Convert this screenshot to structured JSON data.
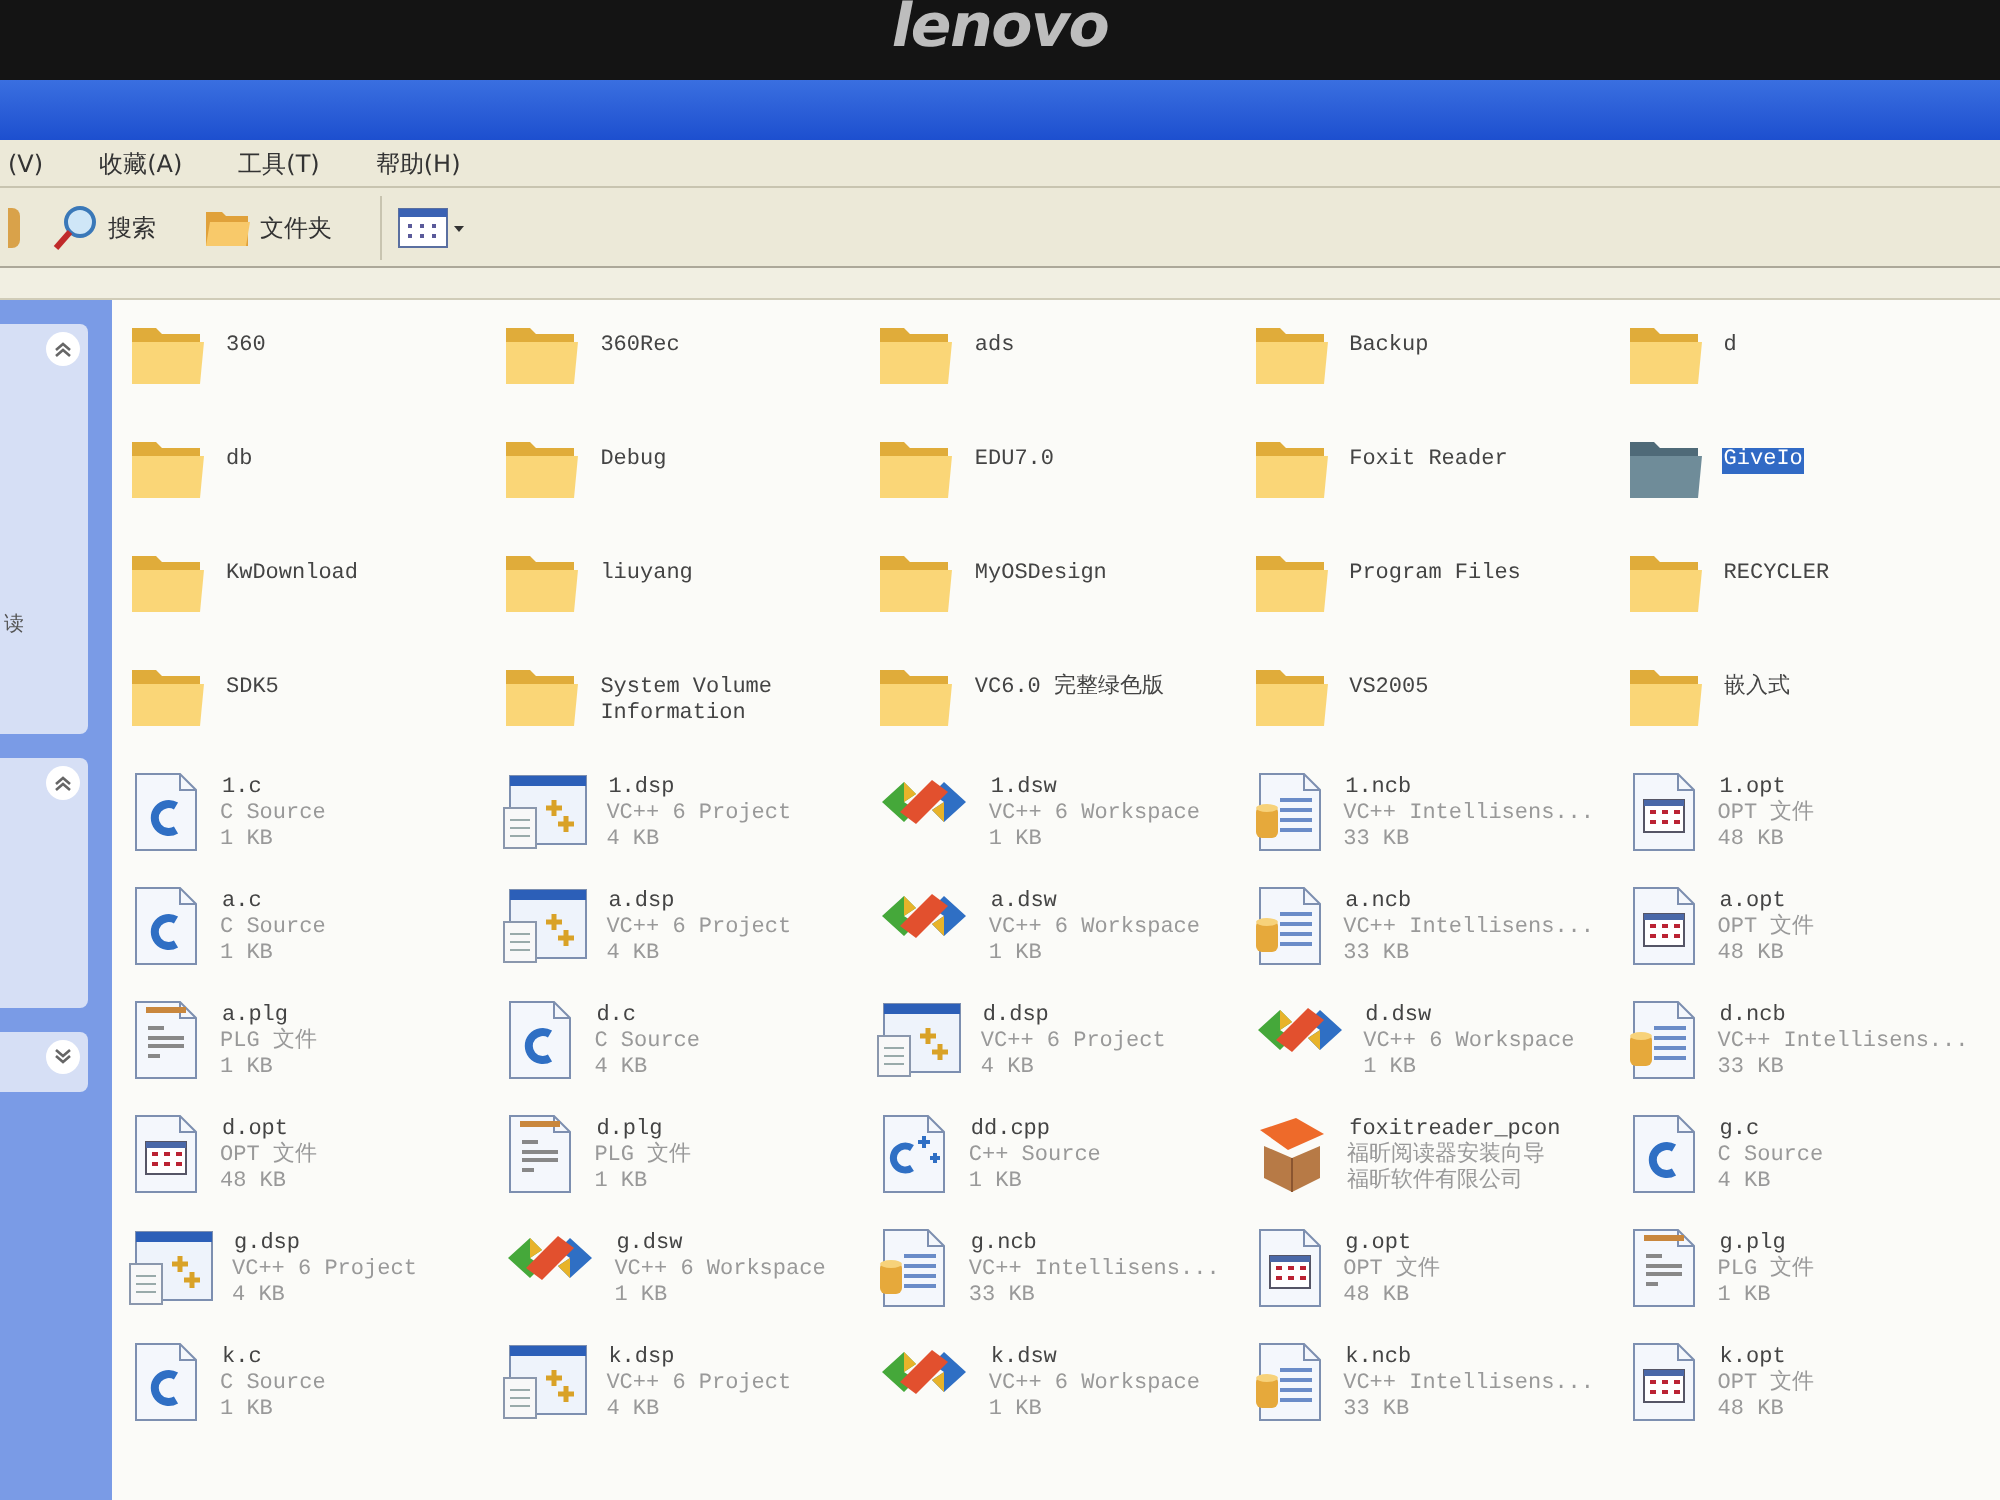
{
  "bezel": {
    "logo": "lenovo"
  },
  "menu": [
    "(V)",
    "收藏(A)",
    "工具(T)",
    "帮助(H)"
  ],
  "toolbar": [
    {
      "kind": "search",
      "label": "搜索"
    },
    {
      "kind": "folders",
      "label": "文件夹"
    },
    {
      "kind": "views"
    }
  ],
  "task_pane": {
    "text": "读",
    "panels": [
      {
        "expanded": true
      },
      {
        "expanded": true
      },
      {
        "expanded": false
      }
    ]
  },
  "items": [
    {
      "kind": "folder",
      "name": "360",
      "selected": false
    },
    {
      "kind": "folder",
      "name": "360Rec",
      "selected": false
    },
    {
      "kind": "folder",
      "name": "ads",
      "selected": false
    },
    {
      "kind": "folder",
      "name": "Backup",
      "selected": false
    },
    {
      "kind": "folder",
      "name": "d",
      "selected": false
    },
    {
      "kind": "folder",
      "name": "db",
      "selected": false
    },
    {
      "kind": "folder",
      "name": "Debug",
      "selected": false
    },
    {
      "kind": "folder",
      "name": "EDU7.0",
      "selected": false
    },
    {
      "kind": "folder",
      "name": "Foxit Reader",
      "selected": false
    },
    {
      "kind": "folder",
      "name": "GiveIo",
      "selected": true
    },
    {
      "kind": "folder",
      "name": "KwDownload",
      "selected": false
    },
    {
      "kind": "folder",
      "name": "liuyang",
      "selected": false
    },
    {
      "kind": "folder",
      "name": "MyOSDesign",
      "selected": false
    },
    {
      "kind": "folder",
      "name": "Program Files",
      "selected": false
    },
    {
      "kind": "folder",
      "name": "RECYCLER",
      "selected": false
    },
    {
      "kind": "folder",
      "name": "SDK5",
      "selected": false
    },
    {
      "kind": "folder",
      "name": "System Volume Information",
      "selected": false
    },
    {
      "kind": "folder",
      "name": "VC6.0 完整绿色版",
      "selected": false
    },
    {
      "kind": "folder",
      "name": "VS2005",
      "selected": false
    },
    {
      "kind": "folder",
      "name": "嵌入式",
      "selected": false
    },
    {
      "kind": "c",
      "name": "1.c",
      "lines": [
        "C Source",
        "1 KB"
      ],
      "selected": false
    },
    {
      "kind": "dsp",
      "name": "1.dsp",
      "lines": [
        "VC++ 6 Project",
        "4 KB"
      ],
      "selected": false
    },
    {
      "kind": "dsw",
      "name": "1.dsw",
      "lines": [
        "VC++ 6 Workspace",
        "1 KB"
      ],
      "selected": false
    },
    {
      "kind": "ncb",
      "name": "1.ncb",
      "lines": [
        "VC++ Intellisens...",
        "33 KB"
      ],
      "selected": false
    },
    {
      "kind": "opt",
      "name": "1.opt",
      "lines": [
        "OPT 文件",
        "48 KB"
      ],
      "selected": false
    },
    {
      "kind": "c",
      "name": "a.c",
      "lines": [
        "C Source",
        "1 KB"
      ],
      "selected": false
    },
    {
      "kind": "dsp",
      "name": "a.dsp",
      "lines": [
        "VC++ 6 Project",
        "4 KB"
      ],
      "selected": false
    },
    {
      "kind": "dsw",
      "name": "a.dsw",
      "lines": [
        "VC++ 6 Workspace",
        "1 KB"
      ],
      "selected": false
    },
    {
      "kind": "ncb",
      "name": "a.ncb",
      "lines": [
        "VC++ Intellisens...",
        "33 KB"
      ],
      "selected": false
    },
    {
      "kind": "opt",
      "name": "a.opt",
      "lines": [
        "OPT 文件",
        "48 KB"
      ],
      "selected": false
    },
    {
      "kind": "plg",
      "name": "a.plg",
      "lines": [
        "PLG 文件",
        "1 KB"
      ],
      "selected": false
    },
    {
      "kind": "c",
      "name": "d.c",
      "lines": [
        "C Source",
        "4 KB"
      ],
      "selected": false
    },
    {
      "kind": "dsp",
      "name": "d.dsp",
      "lines": [
        "VC++ 6 Project",
        "4 KB"
      ],
      "selected": false
    },
    {
      "kind": "dsw",
      "name": "d.dsw",
      "lines": [
        "VC++ 6 Workspace",
        "1 KB"
      ],
      "selected": false
    },
    {
      "kind": "ncb",
      "name": "d.ncb",
      "lines": [
        "VC++ Intellisens...",
        "33 KB"
      ],
      "selected": false
    },
    {
      "kind": "opt",
      "name": "d.opt",
      "lines": [
        "OPT 文件",
        "48 KB"
      ],
      "selected": false
    },
    {
      "kind": "plg",
      "name": "d.plg",
      "lines": [
        "PLG 文件",
        "1 KB"
      ],
      "selected": false
    },
    {
      "kind": "cpp",
      "name": "dd.cpp",
      "lines": [
        "C++ Source",
        "1 KB"
      ],
      "selected": false
    },
    {
      "kind": "installer",
      "name": "foxitreader_pcon",
      "lines": [
        "福昕阅读器安装向导",
        "福昕软件有限公司"
      ],
      "selected": false
    },
    {
      "kind": "c",
      "name": "g.c",
      "lines": [
        "C Source",
        "4 KB"
      ],
      "selected": false
    },
    {
      "kind": "dsp",
      "name": "g.dsp",
      "lines": [
        "VC++ 6 Project",
        "4 KB"
      ],
      "selected": false
    },
    {
      "kind": "dsw",
      "name": "g.dsw",
      "lines": [
        "VC++ 6 Workspace",
        "1 KB"
      ],
      "selected": false
    },
    {
      "kind": "ncb",
      "name": "g.ncb",
      "lines": [
        "VC++ Intellisens...",
        "33 KB"
      ],
      "selected": false
    },
    {
      "kind": "opt",
      "name": "g.opt",
      "lines": [
        "OPT 文件",
        "48 KB"
      ],
      "selected": false
    },
    {
      "kind": "plg",
      "name": "g.plg",
      "lines": [
        "PLG 文件",
        "1 KB"
      ],
      "selected": false
    },
    {
      "kind": "c",
      "name": "k.c",
      "lines": [
        "C Source",
        "1 KB"
      ],
      "selected": false
    },
    {
      "kind": "dsp",
      "name": "k.dsp",
      "lines": [
        "VC++ 6 Project",
        "4 KB"
      ],
      "selected": false
    },
    {
      "kind": "dsw",
      "name": "k.dsw",
      "lines": [
        "VC++ 6 Workspace",
        "1 KB"
      ],
      "selected": false
    },
    {
      "kind": "ncb",
      "name": "k.ncb",
      "lines": [
        "VC++ Intellisens...",
        "33 KB"
      ],
      "selected": false
    },
    {
      "kind": "opt",
      "name": "k.opt",
      "lines": [
        "OPT 文件",
        "48 KB"
      ],
      "selected": false
    }
  ]
}
